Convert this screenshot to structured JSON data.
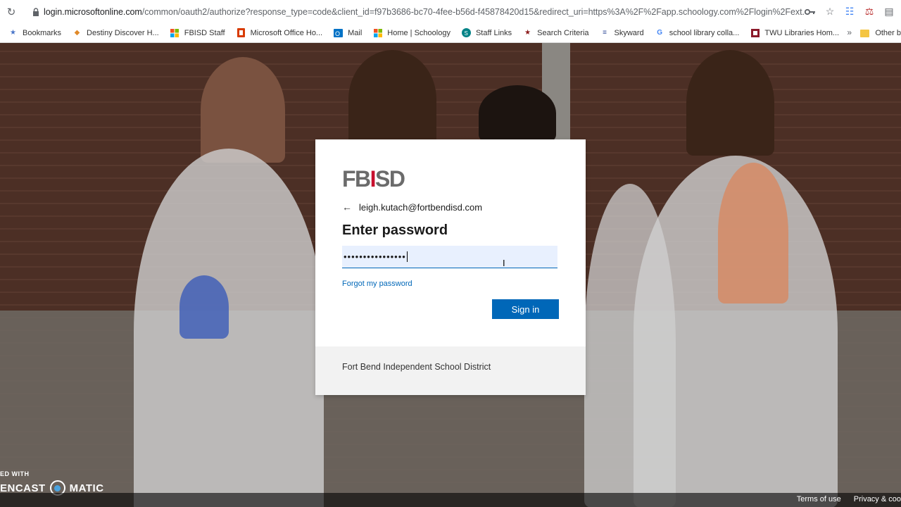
{
  "browser": {
    "url_host": "login.microsoftonline.com",
    "url_rest": "/common/oauth2/authorize?response_type=code&client_id=f97b3686-bc70-4fee-b56d-f45878420d15&redirect_uri=https%3A%2F%2Fapp.schoology.com%2Flogin%2Fext..."
  },
  "bookmarks": [
    {
      "label": "Bookmarks",
      "icon": "star-icon"
    },
    {
      "label": "Destiny Discover H...",
      "icon": "destiny-icon"
    },
    {
      "label": "FBISD Staff",
      "icon": "windows-icon"
    },
    {
      "label": "Microsoft Office Ho...",
      "icon": "office-icon"
    },
    {
      "label": "Mail",
      "icon": "outlook-icon"
    },
    {
      "label": "Home | Schoology",
      "icon": "windows-icon"
    },
    {
      "label": "Staff Links",
      "icon": "sharepoint-icon"
    },
    {
      "label": "Search Criteria",
      "icon": "star-icon"
    },
    {
      "label": "Skyward",
      "icon": "skyward-icon"
    },
    {
      "label": "school library colla...",
      "icon": "google-icon"
    },
    {
      "label": "TWU Libraries Hom...",
      "icon": "twu-icon"
    }
  ],
  "bookmarks_other": "Other b",
  "card": {
    "logo_text": "FBISD",
    "identity": "leigh.kutach@fortbendisd.com",
    "heading": "Enter password",
    "password_value": "••••••••••••••••",
    "forgot_label": "Forgot my password",
    "signin_label": "Sign in",
    "footer_text": "Fort Bend Independent School District"
  },
  "footer": {
    "terms": "Terms of use",
    "privacy": "Privacy & coo"
  },
  "watermark": {
    "line1": "ED WITH",
    "line2a": "ENCAST",
    "line2b": "MATIC"
  },
  "colors": {
    "accent": "#0067b8",
    "logo_red": "#c8102e"
  }
}
